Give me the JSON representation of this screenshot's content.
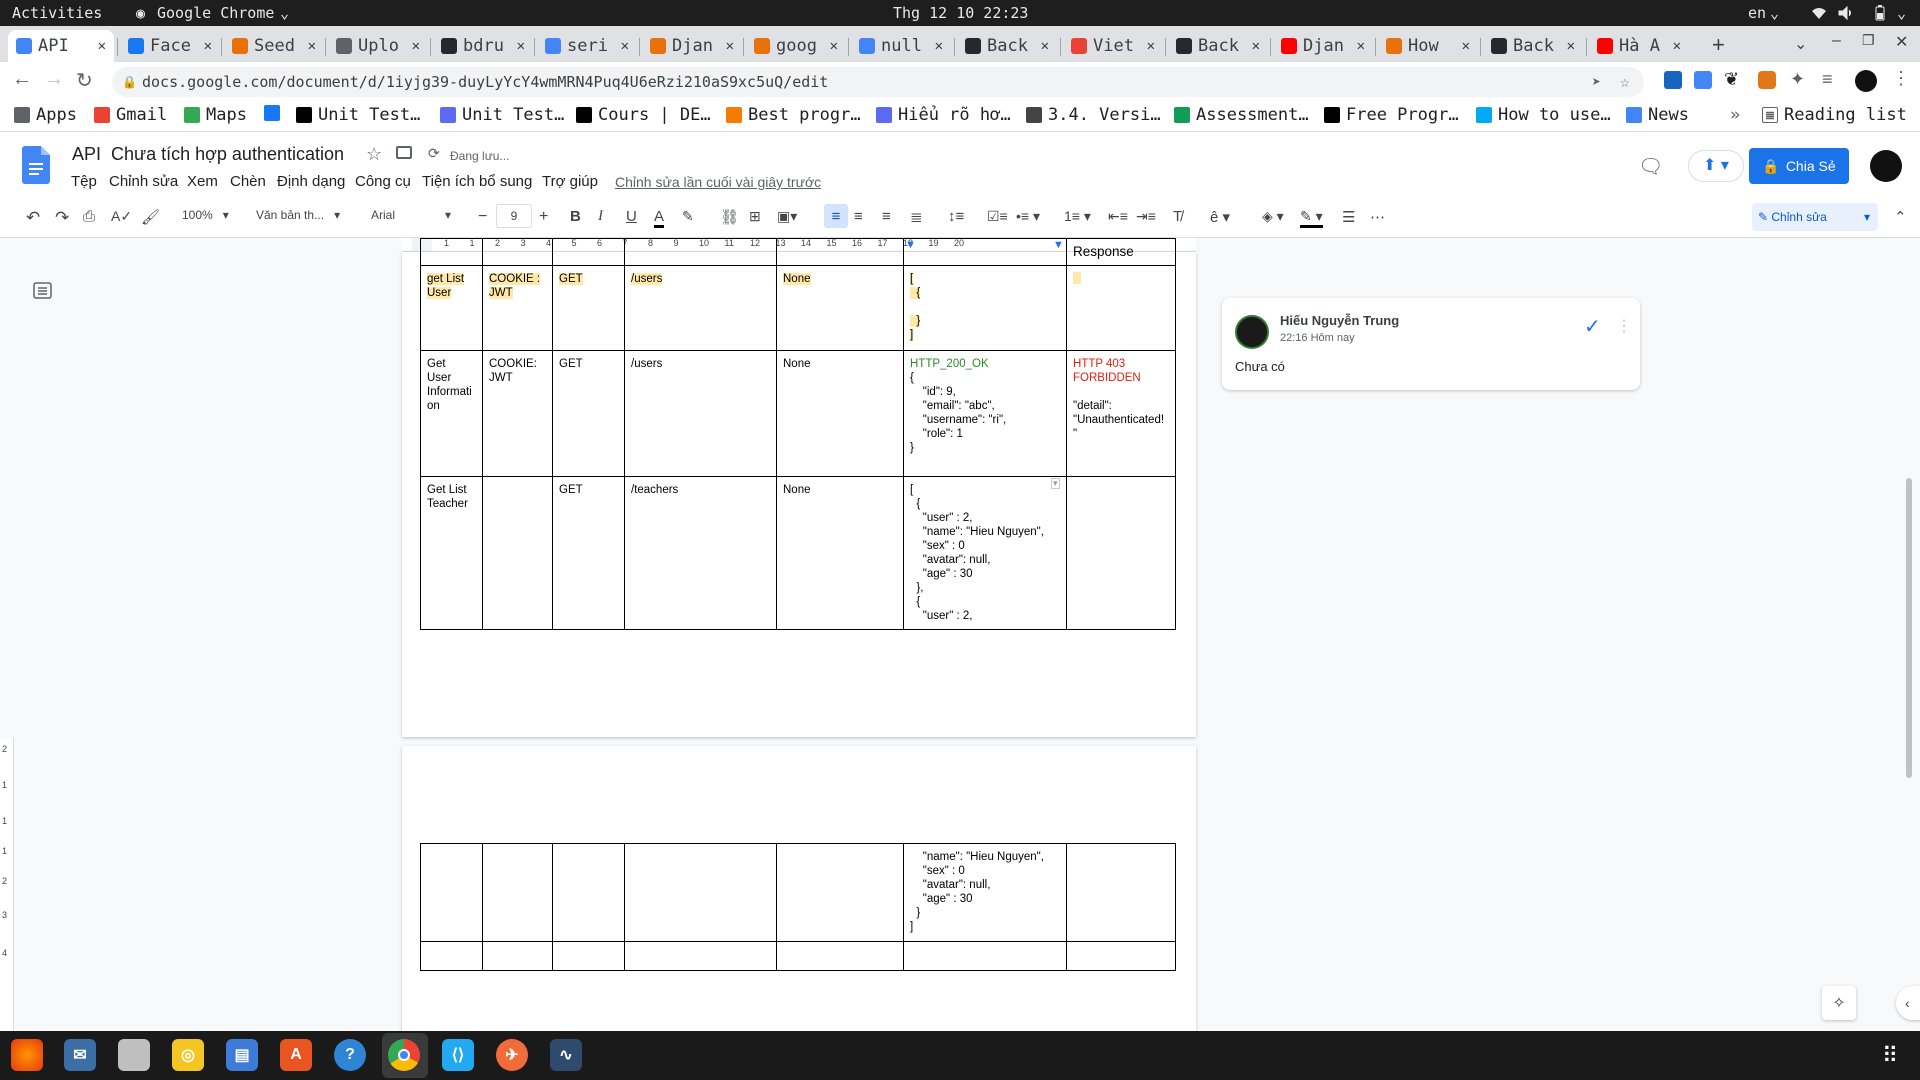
{
  "system_bar": {
    "activities": "Activities",
    "app": "Google Chrome",
    "clock": "Thg 12 10 22:23",
    "lang": "en"
  },
  "tabs": [
    {
      "label": "API",
      "icon": "docs-icon",
      "color": "#4285f4"
    },
    {
      "label": "Face",
      "icon": "facebook-icon",
      "color": "#1877f2"
    },
    {
      "label": "Seed",
      "icon": "seed-icon",
      "color": "#e8710a"
    },
    {
      "label": "Uplo",
      "icon": "globe-icon",
      "color": "#5f6368"
    },
    {
      "label": "bdru",
      "icon": "github-icon",
      "color": "#24292e"
    },
    {
      "label": "seri",
      "icon": "google-icon",
      "color": "#4285f4"
    },
    {
      "label": "Djan",
      "icon": "django-icon",
      "color": "#e8710a"
    },
    {
      "label": "goog",
      "icon": "django-icon",
      "color": "#e8710a"
    },
    {
      "label": "null",
      "icon": "google-icon",
      "color": "#4285f4"
    },
    {
      "label": "Back",
      "icon": "github-icon",
      "color": "#24292e"
    },
    {
      "label": "Viet",
      "icon": "gmail-icon",
      "color": "#ea4335"
    },
    {
      "label": "Back",
      "icon": "github-icon",
      "color": "#24292e"
    },
    {
      "label": "Djan",
      "icon": "youtube-icon",
      "color": "#ff0000"
    },
    {
      "label": "How",
      "icon": "django-icon",
      "color": "#e8710a"
    },
    {
      "label": "Back",
      "icon": "github-icon",
      "color": "#24292e"
    },
    {
      "label": "Hà A",
      "icon": "youtube-icon",
      "color": "#ff0000"
    }
  ],
  "url": "docs.google.com/document/d/1iyjg39-duyLyYcY4wmMRN4Puq4U6eRzi210aS9xc5uQ/edit",
  "bookmarks": [
    {
      "label": "Apps",
      "icon": "apps-icon",
      "color": "#5f6368"
    },
    {
      "label": "Gmail",
      "icon": "gmail-icon",
      "color": "#ea4335"
    },
    {
      "label": "Maps",
      "icon": "maps-icon",
      "color": "#34a853"
    },
    {
      "label": "",
      "icon": "facebook-icon",
      "color": "#1877f2"
    },
    {
      "label": "Unit Test…",
      "icon": "a-icon",
      "color": "#000000"
    },
    {
      "label": "Unit Test…",
      "icon": "v-icon",
      "color": "#5b6af0"
    },
    {
      "label": "Cours | DE…",
      "icon": "x-icon",
      "color": "#000000"
    },
    {
      "label": "Best progr…",
      "icon": "blogger-icon",
      "color": "#f57c00"
    },
    {
      "label": "Hiểu rõ hơ…",
      "icon": "v-icon",
      "color": "#5b6af0"
    },
    {
      "label": "3.4. Versi…",
      "icon": "book-icon",
      "color": "#444444"
    },
    {
      "label": "Assessment…",
      "icon": "plus-icon",
      "color": "#0f9d58"
    },
    {
      "label": "Free Progr…",
      "icon": "flag-icon",
      "color": "#000000"
    },
    {
      "label": "How to use…",
      "icon": "bird-icon",
      "color": "#03a9f4"
    },
    {
      "label": "News",
      "icon": "news-icon",
      "color": "#4285f4"
    }
  ],
  "reading_list": "Reading list",
  "doc": {
    "title": "API  Chưa tích hợp authentication",
    "saving": "Đang lưu...",
    "last_edit": "Chỉnh sửa lần cuối vài giây trước",
    "share": "Chia Sẻ",
    "menu": [
      "Tệp",
      "Chỉnh sửa",
      "Xem",
      "Chèn",
      "Định dạng",
      "Công cụ",
      "Tiện ích bổ sung",
      "Trợ giúp"
    ]
  },
  "toolbar": {
    "zoom": "100%",
    "style": "Văn bản th...",
    "font": "Arial",
    "size": "9",
    "mode": "Chỉnh sửa"
  },
  "ruler": [
    "1",
    "1",
    "2",
    "3",
    "4",
    "5",
    "6",
    "7",
    "8",
    "9",
    "10",
    "11",
    "12",
    "13",
    "14",
    "15",
    "16",
    "17",
    "18",
    "19",
    "20"
  ],
  "vruler": [
    "2",
    "1",
    "1",
    "1",
    "2",
    "3",
    "4"
  ],
  "table1": {
    "header_partial": "Response",
    "rows": [
      [
        "get List\nUser",
        "COOKIE :\nJWT",
        "GET",
        "/users",
        "None",
        "[\n  {\n\n  }\n]",
        ""
      ],
      [
        "Get\nUser\nInformati\non",
        "COOKIE:\nJWT",
        "GET",
        "/users",
        "None",
        "HTTP_200_OK\n{\n    \"id\": 9,\n    \"email\": \"abc\",\n    \"username\": \"ri\",\n    \"role\": 1\n}",
        "HTTP 403\nFORBIDDEN\n\n\"detail\":\n\"Unauthenticated!\n\""
      ],
      [
        "Get List\nTeacher",
        "",
        "GET",
        "/teachers",
        "None",
        "[\n  {\n    \"user\" : 2,\n    \"name\": \"Hieu Nguyen\",\n    \"sex\" : 0\n    \"avatar\": null,\n    \"age\" : 30\n  },\n  {\n    \"user\" : 2,",
        ""
      ]
    ]
  },
  "table2": {
    "cont": "    \"name\": \"Hieu Nguyen\",\n    \"sex\" : 0\n    \"avatar\": null,\n    \"age\" : 30\n  }\n]"
  },
  "comment": {
    "author": "Hiếu Nguyễn Trung",
    "time": "22:16 Hôm nay",
    "text": "Chưa có"
  }
}
